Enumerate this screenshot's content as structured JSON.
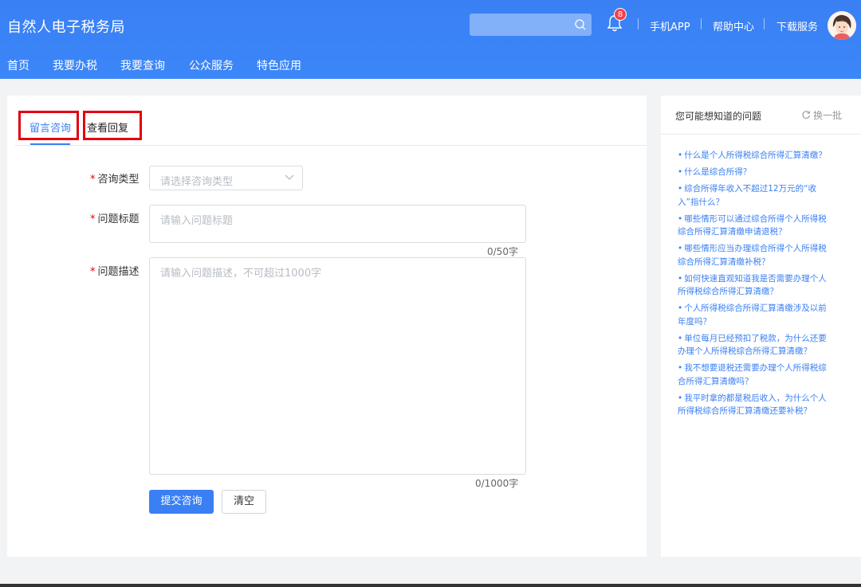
{
  "header": {
    "title": "自然人电子税务局",
    "notification_count": "8",
    "links": [
      "手机APP",
      "帮助中心",
      "下载服务"
    ],
    "nav": [
      "首页",
      "我要办税",
      "我要查询",
      "公众服务",
      "特色应用"
    ]
  },
  "tabs": {
    "message": "留言咨询",
    "reply": "查看回复"
  },
  "form": {
    "type_label": "咨询类型",
    "type_placeholder": "请选择咨询类型",
    "title_label": "问题标题",
    "title_placeholder": "请输入问题标题",
    "title_counter": "0/50字",
    "desc_label": "问题描述",
    "desc_placeholder": "请输入问题描述，不可超过1000字",
    "desc_counter": "0/1000字",
    "submit": "提交咨询",
    "clear": "清空"
  },
  "sidebar": {
    "title": "您可能想知道的问题",
    "refresh": "换一批",
    "questions": [
      "什么是个人所得税综合所得汇算清缴？",
      "什么是综合所得？",
      "综合所得年收入不超过12万元的“收入”指什么？",
      "哪些情形可以通过综合所得个人所得税综合所得汇算清缴申请退税？",
      "哪些情形应当办理综合所得个人所得税综合所得汇算清缴补税？",
      "如何快速直观知道我是否需要办理个人所得税综合所得汇算清缴？",
      "个人所得税综合所得汇算清缴涉及以前年度吗？",
      "单位每月已经预扣了税款，为什么还要办理个人所得税综合所得汇算清缴？",
      "我不想要退税还需要办理个人所得税综合所得汇算清缴吗？",
      "我平时拿的都是税后收入，为什么个人所得税综合所得汇算清缴还要补税？"
    ]
  },
  "colors": {
    "brand": "#3a7ff3",
    "highlight": "#e3000f"
  }
}
